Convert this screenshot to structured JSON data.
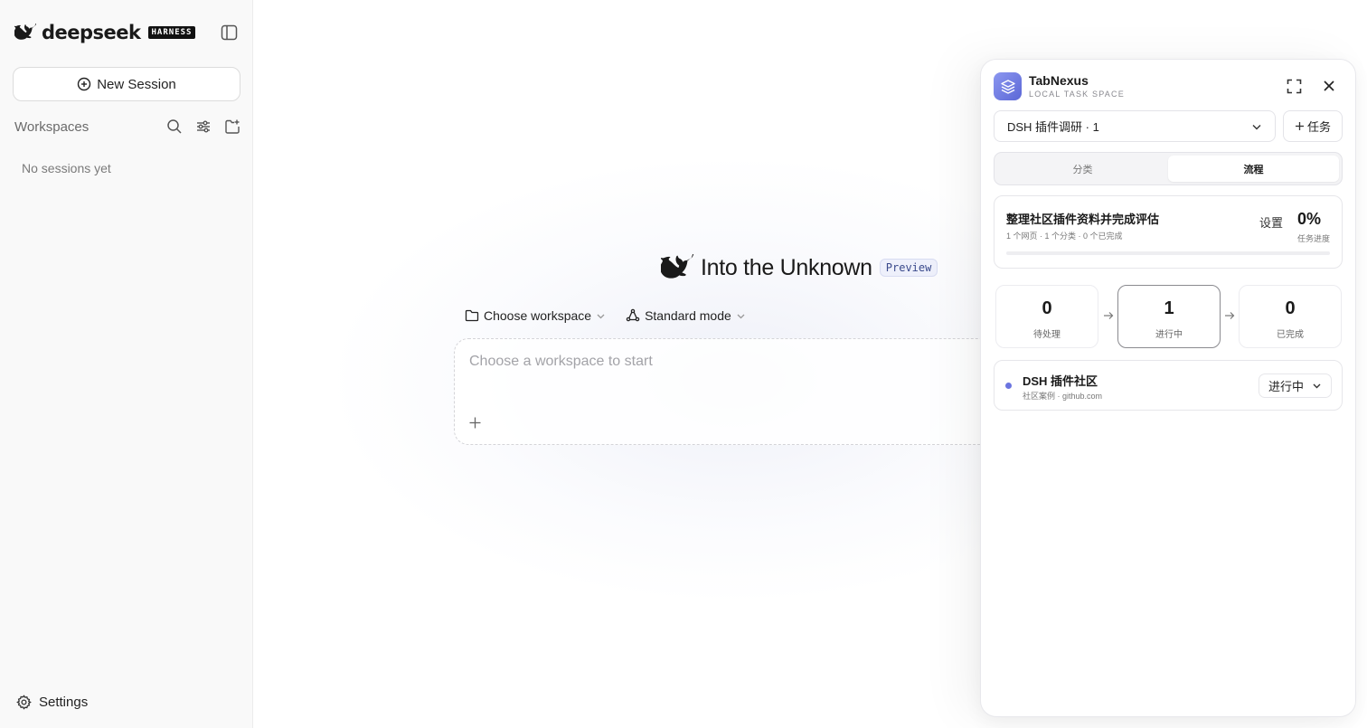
{
  "sidebar": {
    "brand_name": "deepseek",
    "brand_tag": "HARNESS",
    "new_session_label": "New Session",
    "workspaces_label": "Workspaces",
    "empty_text": "No sessions yet",
    "settings_label": "Settings"
  },
  "main": {
    "hero_title": "Into the Unknown",
    "preview_badge": "Preview",
    "workspace_chooser": "Choose workspace",
    "mode_chooser": "Standard mode",
    "composer_placeholder": "Choose a workspace to start"
  },
  "panel": {
    "title": "TabNexus",
    "subtitle": "LOCAL TASK SPACE",
    "project_select": "DSH 插件调研 · 1",
    "add_task_label": "任务",
    "tabs": [
      {
        "label": "分类",
        "active": false
      },
      {
        "label": "流程",
        "active": true
      }
    ],
    "task": {
      "title": "整理社区插件资料并完成评估",
      "meta": "1 个网页 · 1 个分类 · 0 个已完成",
      "settings_label": "设置",
      "progress_text": "0%",
      "progress_value": 0,
      "progress_label": "任务进度"
    },
    "stages": [
      {
        "count": "0",
        "label": "待处理"
      },
      {
        "count": "1",
        "label": "进行中"
      },
      {
        "count": "0",
        "label": "已完成"
      }
    ],
    "item": {
      "title": "DSH 插件社区",
      "subtitle": "社区案例 · github.com",
      "status": "进行中"
    }
  },
  "colors": {
    "accent": "#6b74e0",
    "logo_gradient_start": "#8c97f0",
    "logo_gradient_end": "#5b67d6"
  }
}
